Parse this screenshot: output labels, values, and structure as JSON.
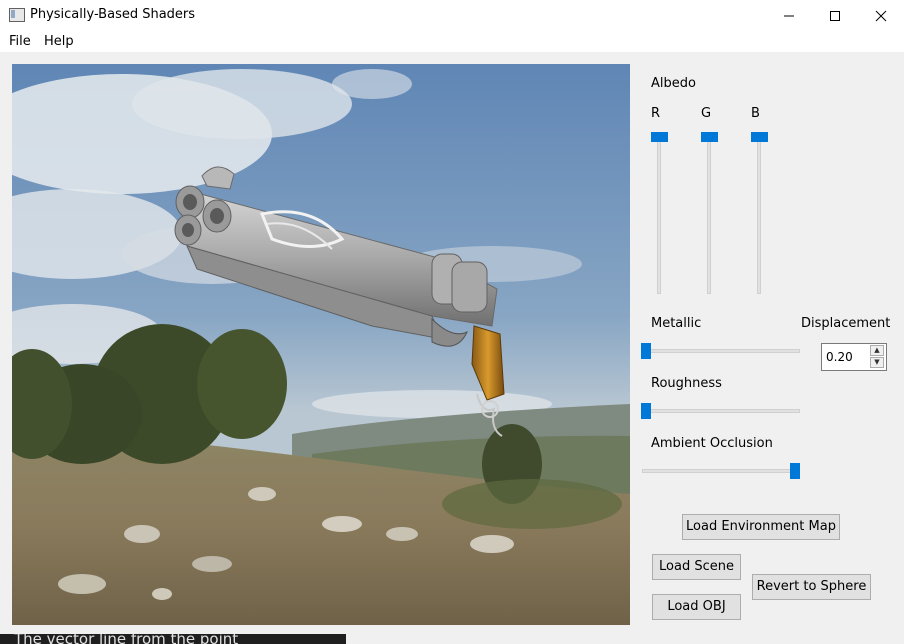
{
  "window": {
    "title": "Physically-Based Shaders",
    "minimize_icon": "minimize-icon",
    "maximize_icon": "maximize-icon",
    "close_icon": "close-icon"
  },
  "menu": {
    "items": [
      "File",
      "Help"
    ]
  },
  "controls": {
    "albedo_label": "Albedo",
    "channels": [
      "R",
      "G",
      "B"
    ],
    "albedo_values": {
      "r": 1.0,
      "g": 1.0,
      "b": 1.0
    },
    "metallic_label": "Metallic",
    "metallic_value": 0.0,
    "roughness_label": "Roughness",
    "roughness_value": 0.0,
    "ao_label": "Ambient Occlusion",
    "ao_value": 1.0,
    "displacement_label": "Displacement",
    "displacement_value": "0.20"
  },
  "buttons": {
    "load_env": "Load Environment Map",
    "load_scene": "Load Scene",
    "revert": "Revert to Sphere",
    "load_obj": "Load OBJ"
  },
  "bottom_overlay_text": "The vector line from the point",
  "colors": {
    "accent": "#0078d7"
  }
}
